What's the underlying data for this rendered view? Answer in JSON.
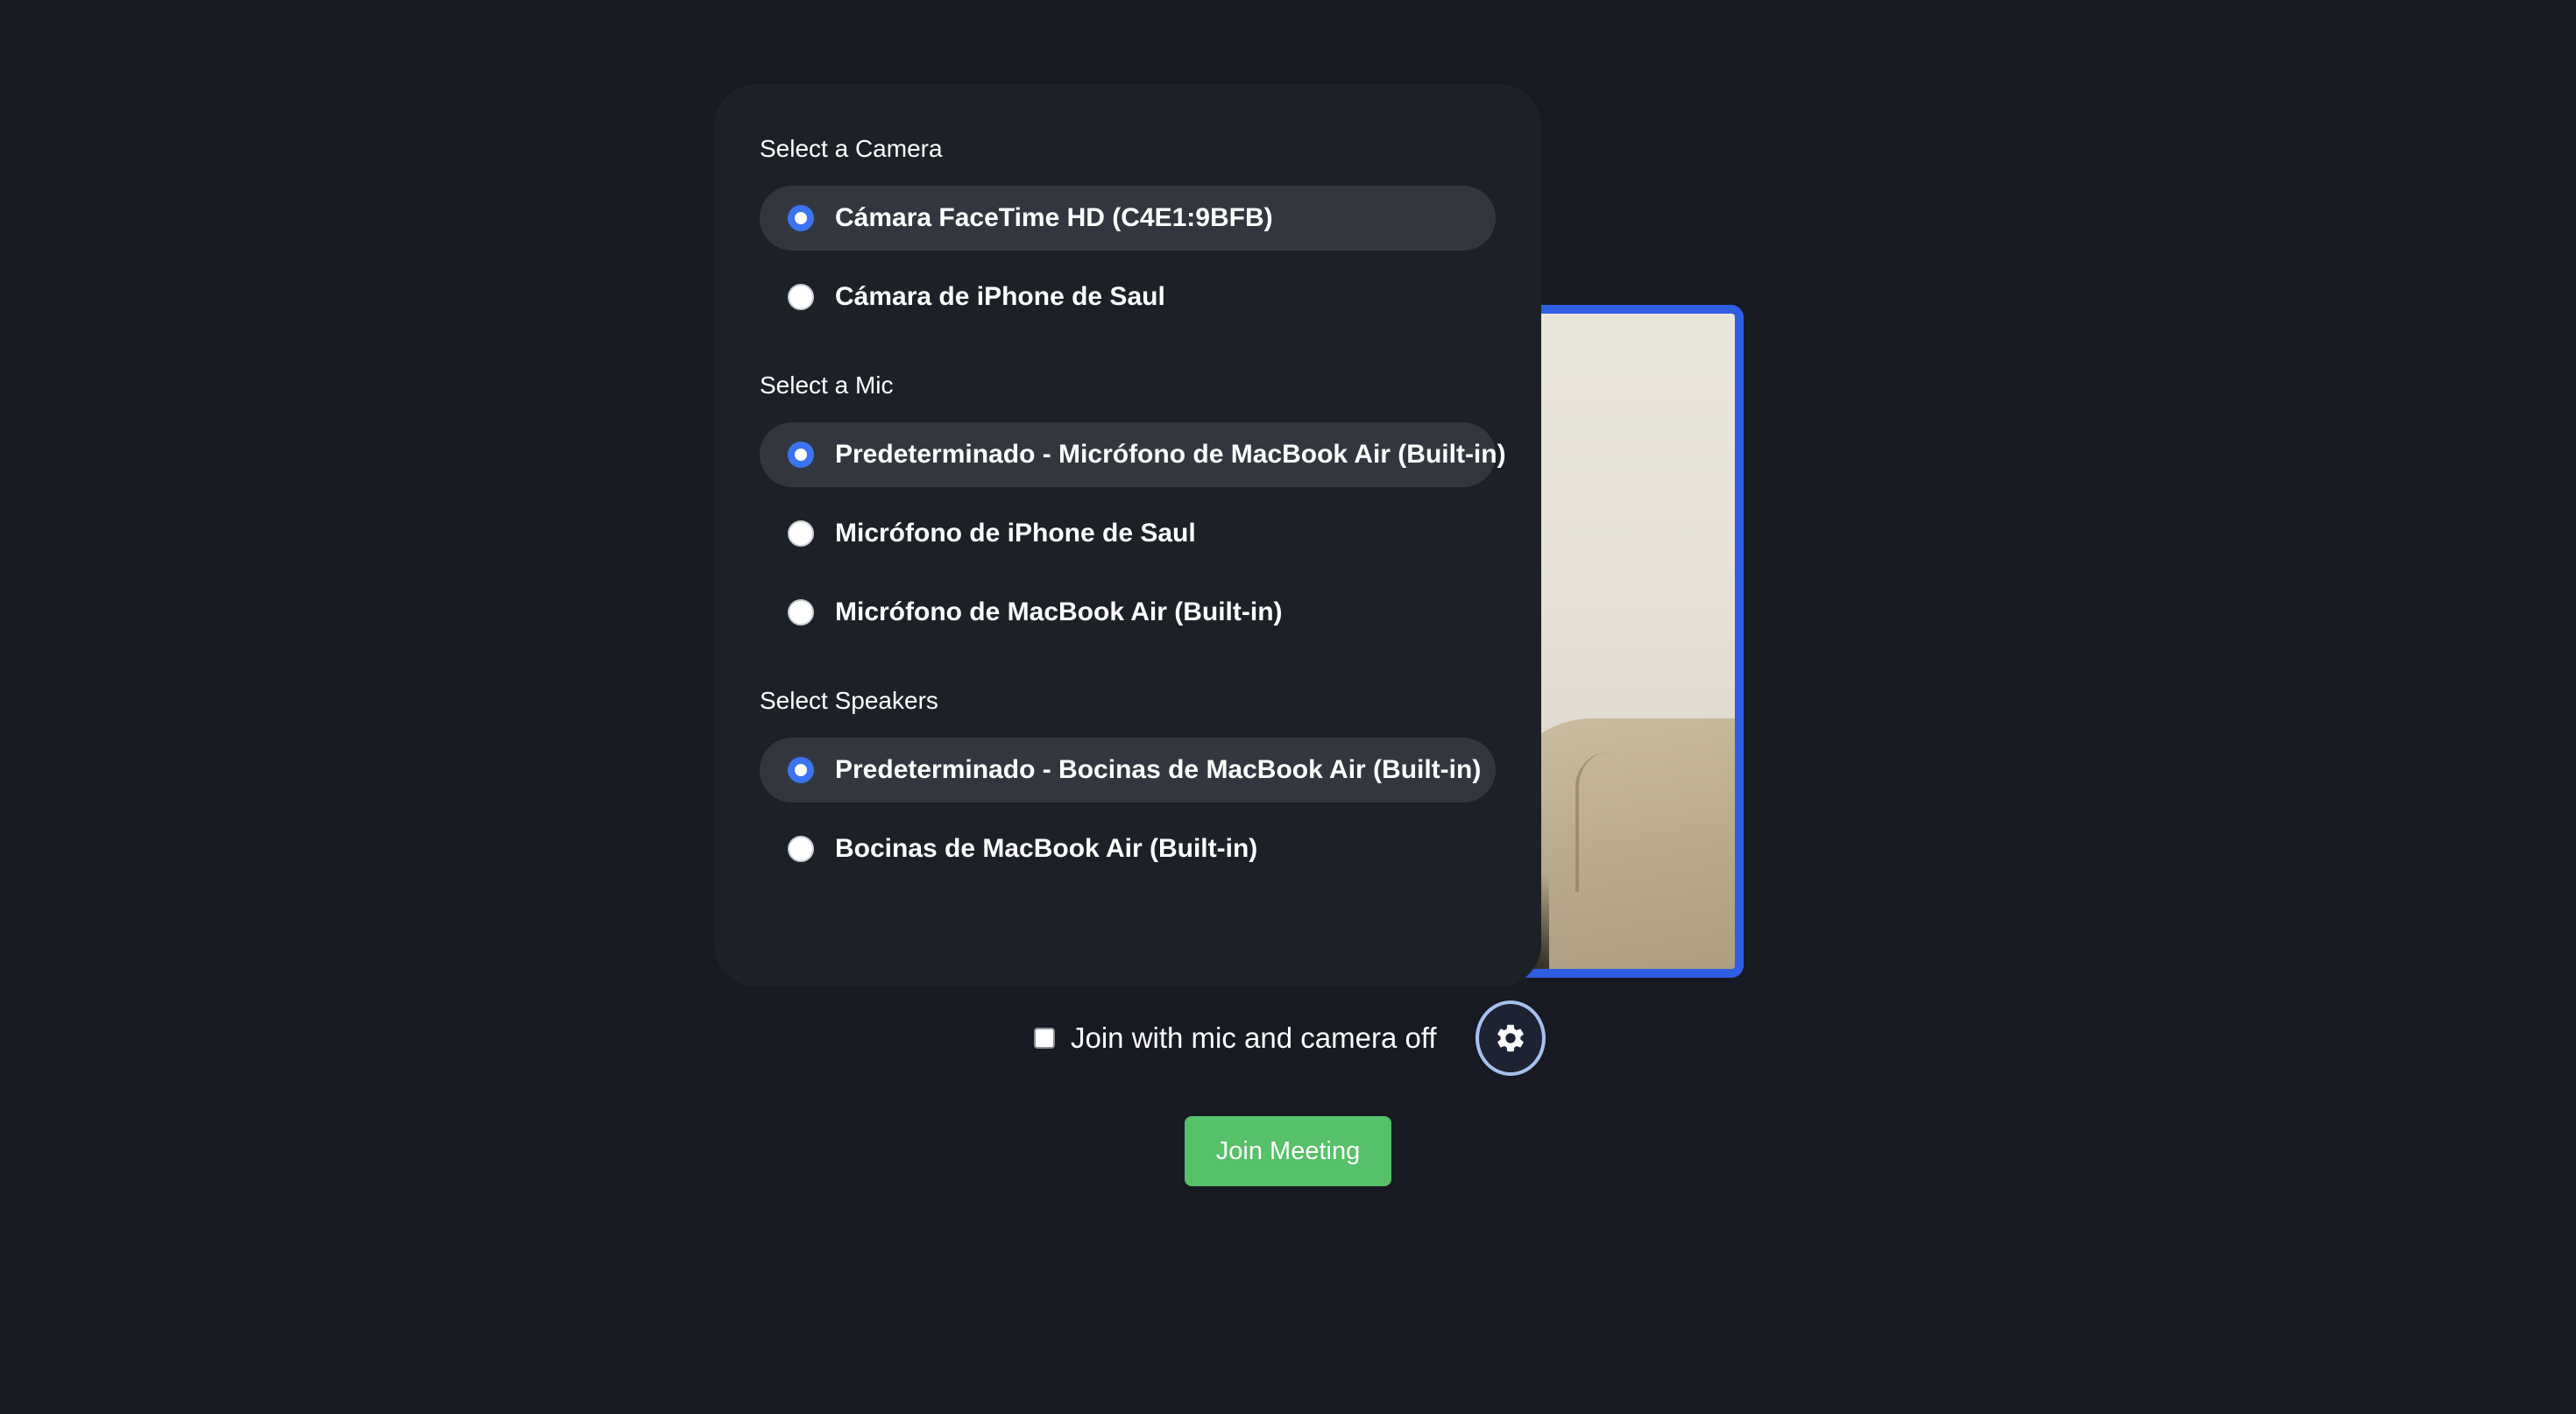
{
  "camera": {
    "label": "Select a Camera",
    "options": [
      {
        "label": "Cámara FaceTime HD (C4E1:9BFB)",
        "selected": true
      },
      {
        "label": "Cámara de iPhone de Saul",
        "selected": false
      }
    ]
  },
  "mic": {
    "label": "Select a Mic",
    "options": [
      {
        "label": "Predeterminado - Micrófono de MacBook Air (Built-in)",
        "selected": true
      },
      {
        "label": "Micrófono de iPhone de Saul",
        "selected": false
      },
      {
        "label": "Micrófono de MacBook Air (Built-in)",
        "selected": false
      }
    ]
  },
  "speakers": {
    "label": "Select Speakers",
    "options": [
      {
        "label": "Predeterminado - Bocinas de MacBook Air (Built-in)",
        "selected": true
      },
      {
        "label": "Bocinas de MacBook Air (Built-in)",
        "selected": false
      }
    ]
  },
  "join_options": {
    "checkbox_label": "Join with mic and camera off",
    "checked": false,
    "settings_icon": "gear-icon"
  },
  "join_button": {
    "label": "Join Meeting"
  },
  "colors": {
    "background": "#171923",
    "panel": "#1c2128",
    "selected_row": "#32373f",
    "accent_blue": "#3b74f0",
    "video_border": "#2f5ee3",
    "join_green": "#56c168"
  }
}
